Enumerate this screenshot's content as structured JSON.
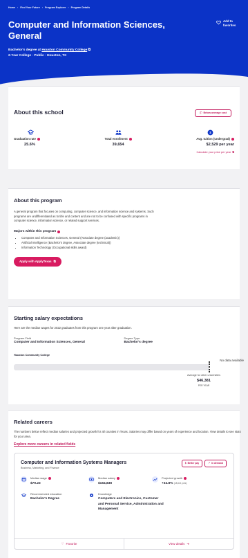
{
  "breadcrumb": [
    "Home",
    "Find Your Future",
    "Program Explorer",
    "Program Details"
  ],
  "hero": {
    "title": "Computer and Information Sciences, General",
    "favorite_label": "Add to favorites",
    "degree_prefix": "Bachelor's degree at",
    "college_link": "Houston Community College",
    "meta": "2-Year College · Public · Houston, TX"
  },
  "about_school": {
    "heading": "About this school",
    "averages_button": "Below average cost",
    "stats": [
      {
        "label": "Graduation rate",
        "value": "25.6%",
        "icon": "graduation-icon"
      },
      {
        "label": "Total enrollment",
        "value": "39,654",
        "icon": "people-icon"
      },
      {
        "label": "Avg. tuition (undergrad)",
        "value": "$2,529 per year",
        "icon": "coin-icon"
      }
    ],
    "calc_link": "Calculate your price per year"
  },
  "program": {
    "heading": "About this program",
    "description": "A general program that focuses on computing, computer science, and information science and systems. Such programs are undifferentiated as to title and content and are not to be confused with specific programs in computer science, information science, or related support services.",
    "majors_heading": "Majors within this program",
    "majors": [
      "Computer and Information Sciences, General (Associate degree (academic))",
      "Artificial Intelligence (Bachelor's degree, Associate degree (technical))",
      "Information Technology (Occupational skills award)"
    ],
    "apply_button": "Apply with ApplyTexas"
  },
  "salary": {
    "heading": "Starting salary expectations",
    "subtitle": "Here are the median wages for 2022 graduates from this program one year after graduation.",
    "program_field_label": "Program Field",
    "program_field_value": "Computer and Information Sciences, General",
    "degree_type_label": "Degree Type",
    "degree_type_value": "Bachelor's degree",
    "school_label": "Houston Community College",
    "no_data": "No data available",
    "avg_label": "Average for other universities",
    "avg_value": "$46,381",
    "avg_unit": "PER YEAR"
  },
  "careers": {
    "heading": "Related careers",
    "subtitle": "The numbers below reflect median salaries and projected growth for all counties in Texas. Salaries may differ based on years of experience and location. View details to see stats for your area.",
    "explore_link": "Explore more careers in related fields",
    "card": {
      "title": "Computer and Information Systems Managers",
      "category": "Business, Marketing, and Finance",
      "btn_pay": "Better pay",
      "btn_demand": "In demand",
      "median_wage_label": "Median wage",
      "median_wage_value": "$79.23",
      "median_salary_label": "Median salary",
      "median_salary_value": "$164,838",
      "growth_label": "Projected growth",
      "growth_value": "+34.8%",
      "growth_note": "(18,621 jobs)",
      "education_label": "Recommended education",
      "education_value": "Bachelor's Degree",
      "knowledge_label": "Knowledge",
      "knowledge_value": "Computers and Electronics, Customer and Personal Service, Administration and Management",
      "favorite_label": "Favorite",
      "details_label": "View details"
    }
  },
  "colors": {
    "brand_blue": "#0b33c7",
    "accent_pink": "#c2185b"
  }
}
